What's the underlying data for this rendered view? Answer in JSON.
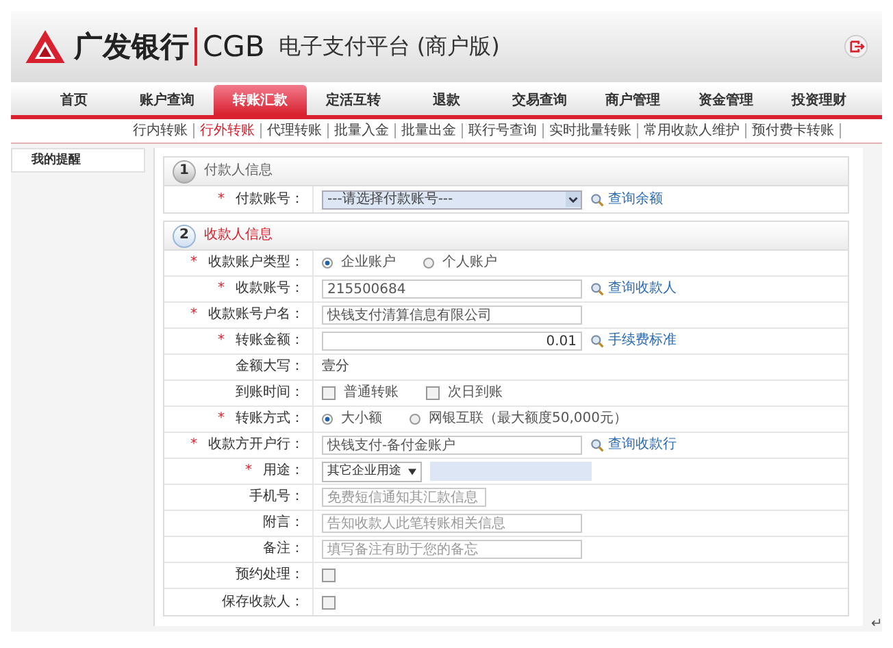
{
  "header": {
    "brand": "广发银行",
    "brand_en": "CGB",
    "title": "电子支付平台 (商户版)"
  },
  "nav": [
    {
      "label": "首页",
      "selected": false
    },
    {
      "label": "账户查询",
      "selected": false
    },
    {
      "label": "转账汇款",
      "selected": true
    },
    {
      "label": "定活互转",
      "selected": false
    },
    {
      "label": "退款",
      "selected": false
    },
    {
      "label": "交易查询",
      "selected": false
    },
    {
      "label": "商户管理",
      "selected": false
    },
    {
      "label": "资金管理",
      "selected": false
    },
    {
      "label": "投资理财",
      "selected": false
    }
  ],
  "subnav": [
    {
      "label": "行内转账",
      "selected": false
    },
    {
      "label": "行外转账",
      "selected": true
    },
    {
      "label": "代理转账",
      "selected": false
    },
    {
      "label": "批量入金",
      "selected": false
    },
    {
      "label": "批量出金",
      "selected": false
    },
    {
      "label": "联行号查询",
      "selected": false
    },
    {
      "label": "实时批量转账",
      "selected": false
    },
    {
      "label": "常用收款人维护",
      "selected": false
    },
    {
      "label": "预付费卡转账",
      "selected": false
    }
  ],
  "sidebar": {
    "items": [
      {
        "label": "我的提醒"
      }
    ]
  },
  "sections": [
    {
      "number": "1",
      "title": "付款人信息",
      "active": false,
      "rows": [
        {
          "kind": "select",
          "label": "付款账号：",
          "required": true,
          "value": "---请选择付款账号---",
          "link": "查询余额"
        }
      ]
    },
    {
      "number": "2",
      "title": "收款人信息",
      "active": true,
      "rows": [
        {
          "kind": "radio",
          "label": "收款账户类型：",
          "required": true,
          "options": [
            {
              "label": "企业账户",
              "selected": true
            },
            {
              "label": "个人账户",
              "selected": false
            }
          ]
        },
        {
          "kind": "input",
          "label": "收款账号：",
          "required": true,
          "value": "215500684",
          "link": "查询收款人"
        },
        {
          "kind": "input",
          "label": "收款账号户名：",
          "required": true,
          "value": "快钱支付清算信息有限公司"
        },
        {
          "kind": "amount",
          "label": "转账金额：",
          "required": true,
          "value": "0.01",
          "link": "手续费标准"
        },
        {
          "kind": "text",
          "label": "金额大写：",
          "required": false,
          "value": "壹分"
        },
        {
          "kind": "checks",
          "label": "到账时间：",
          "required": false,
          "options": [
            {
              "label": "普通转账",
              "checked": false
            },
            {
              "label": "次日到账",
              "checked": false
            }
          ]
        },
        {
          "kind": "radio",
          "label": "转账方式：",
          "required": true,
          "options": [
            {
              "label": "大小额",
              "selected": true
            },
            {
              "label": "网银互联（最大额度50,000元）",
              "selected": false
            }
          ]
        },
        {
          "kind": "input",
          "label": "收款方开户行：",
          "required": true,
          "value": "快钱支付-备付金账户",
          "link": "查询收款行"
        },
        {
          "kind": "purpose",
          "label": "用途：",
          "required": true,
          "value": "其它企业用途"
        },
        {
          "kind": "short-input",
          "label": "手机号：",
          "required": false,
          "placeholder": "免费短信通知其汇款信息"
        },
        {
          "kind": "input",
          "label": "附言：",
          "required": false,
          "placeholder": "告知收款人此笔转账相关信息"
        },
        {
          "kind": "input",
          "label": "备注：",
          "required": false,
          "placeholder": "填写备注有助于您的备忘"
        },
        {
          "kind": "checkbox",
          "label": "预约处理：",
          "required": false,
          "checked": false
        },
        {
          "kind": "checkbox",
          "label": "保存收款人：",
          "required": false,
          "checked": false
        }
      ]
    }
  ],
  "required_mark": "*",
  "end_mark": "↵"
}
